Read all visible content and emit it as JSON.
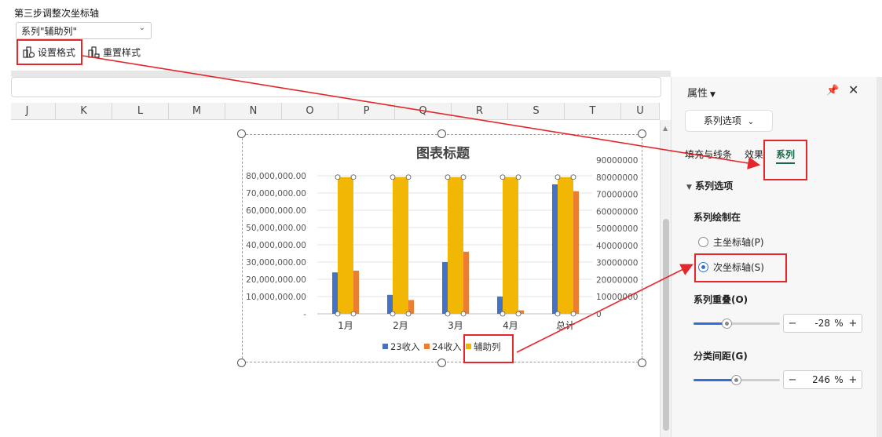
{
  "step_title": "第三步调整次坐标轴",
  "series_select": {
    "value": "系列\"辅助列\"",
    "icon": "chevron-down-icon"
  },
  "toolbar": {
    "format_label": "设置格式",
    "reset_label": "重置样式"
  },
  "columns": [
    "J",
    "K",
    "L",
    "M",
    "N",
    "O",
    "P",
    "Q",
    "R",
    "S",
    "T",
    "U"
  ],
  "panel": {
    "title": "属性",
    "series_options_button": "系列选项",
    "tabs": [
      "填充与线条",
      "效果",
      "系列"
    ],
    "active_tab": "系列",
    "section_title": "系列选项",
    "plot_on_label": "系列绘制在",
    "primary_axis_label": "主坐标轴(P)",
    "secondary_axis_label": "次坐标轴(S)",
    "selected_axis": "secondary",
    "overlap_label": "系列重叠(O)",
    "overlap_value": "-28",
    "gap_label": "分类间距(G)",
    "gap_value": "246",
    "unit": "%",
    "minus": "−",
    "plus": "+"
  },
  "colors": {
    "series_23": "#4472c4",
    "series_24": "#ed7d31",
    "aux": "#f2b705",
    "annotation_red": "#e5262b",
    "accent_green": "#176b49"
  },
  "chart_data": {
    "type": "bar",
    "title": "图表标题",
    "categories": [
      "1月",
      "2月",
      "3月",
      "4月",
      "总计"
    ],
    "series": [
      {
        "name": "23收入",
        "axis": "primary",
        "values": [
          24000000,
          11000000,
          30000000,
          10000000,
          75000000
        ]
      },
      {
        "name": "24收入",
        "axis": "primary",
        "values": [
          25000000,
          8000000,
          36000000,
          2000000,
          71000000
        ]
      },
      {
        "name": "辅助列",
        "axis": "secondary",
        "values": [
          80000000,
          80000000,
          80000000,
          80000000,
          80000000
        ]
      }
    ],
    "primary_axis": {
      "ylim": [
        0,
        80000000
      ],
      "ticks": [
        "80,000,000.00",
        "70,000,000.00",
        "60,000,000.00",
        "50,000,000.00",
        "40,000,000.00",
        "30,000,000.00",
        "20,000,000.00",
        "10,000,000.00",
        "-"
      ]
    },
    "secondary_axis": {
      "ylim": [
        0,
        90000000
      ],
      "ticks": [
        "90000000",
        "80000000",
        "70000000",
        "60000000",
        "50000000",
        "40000000",
        "30000000",
        "20000000",
        "10000000",
        "0"
      ]
    },
    "grid": true,
    "legend": "bottom"
  }
}
